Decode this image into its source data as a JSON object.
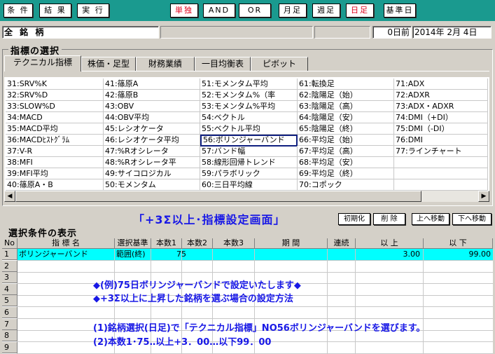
{
  "toolbar": {
    "buttons": [
      {
        "label": "条 件"
      },
      {
        "label": "結 果"
      },
      {
        "label": "実 行"
      },
      {
        "label": "単独",
        "red": true
      },
      {
        "label": "AND"
      },
      {
        "label": "OR"
      },
      {
        "label": "月足"
      },
      {
        "label": "週足"
      },
      {
        "label": "日足",
        "red": true
      },
      {
        "label": "基準日"
      }
    ]
  },
  "header": {
    "stock_value": "全 銘 柄",
    "days_before": "0日前",
    "date": "2014年 2月 4日"
  },
  "indicator_section": {
    "title": "指標の選択",
    "tabs": [
      "テクニカル指標",
      "株価・足型",
      "財務業績",
      "一目均衡表",
      "ピボット"
    ],
    "active_tab": 0,
    "columns": [
      [
        "31:SRV%K",
        "32:SRV%D",
        "33:SLOW%D",
        "34:MACD",
        "35:MACD平均",
        "36:MACDﾋｽﾄｸﾞﾗﾑ",
        "37:V-R",
        "38:MFI",
        "39:MFI平均",
        "40:篠原A・B"
      ],
      [
        "41:篠原A",
        "42:篠原B",
        "43:OBV",
        "44:OBV平均",
        "45:レシオケータ",
        "46:レシオケータ平均",
        "47:%Rオシレータ",
        "48:%Rオシレータ平",
        "49:サイコロジカル",
        "50:モメンタム"
      ],
      [
        "51:モメンタム平均",
        "52:モメンタム%（率",
        "53:モメンタム%平均",
        "54:ベクトル",
        "55:ベクトル平均",
        "56:ボリンジャーバンド",
        "57:バンド幅",
        "58:線形回帰トレンド",
        "59:パラボリック",
        "60:三日平均線"
      ],
      [
        "61:転換足",
        "62:陰陽足（始）",
        "63:陰陽足（高）",
        "64:陰陽足（安）",
        "65:陰陽足（終）",
        "66:平均足（始）",
        "67:平均足（高）",
        "68:平均足（安）",
        "69:平均足（終）",
        "70:コポック"
      ],
      [
        "71:ADX",
        "72:ADXR",
        "73:ADX・ADXR",
        "74:DMI（+DI）",
        "75:DMI（-DI）",
        "76:DMI",
        "77:ラインチャート",
        "",
        "",
        ""
      ]
    ],
    "selected": {
      "col": 2,
      "row": 5
    }
  },
  "banner": "「+3Σ以上･指標設定画面」",
  "action_buttons": [
    "初期化",
    "削 除",
    "上へ移動",
    "下へ移動"
  ],
  "condition_section": {
    "title": "選択条件の表示",
    "headers": [
      "No",
      "指 標 名",
      "選択基準",
      "本数1",
      "本数2",
      "本数3",
      "期 間",
      "連続",
      "以 上",
      "以 下"
    ],
    "row_numbers": [
      "1",
      "2",
      "3",
      "4",
      "5",
      "6",
      "7",
      "8",
      "9"
    ],
    "row1": {
      "name": "ボリンジャーバンド",
      "criterion": "範囲(終)",
      "count1": "75",
      "min": "3.00",
      "max": "99.00"
    }
  },
  "notes": {
    "line1": "◆(例)75日ボリンジャーバンドで設定いたします◆",
    "line2": "◆+3Σ以上に上昇した銘柄を選ぶ場合の設定方法",
    "line3": "(1)銘柄選択(日足)で「テクニカル指標」NO56ボリンジャーバンドを選びます。",
    "line4": "(2)本数1･75‥以上+3．00…以下99．00"
  },
  "colors": {
    "toolbar_bg": "#1a9a8f",
    "selected_row_bg": "#00ffff",
    "note_text": "#1818e6",
    "banner_text": "#1818e6",
    "red_button_text": "#e0001c"
  },
  "icons": {
    "scroll_left": "triangle-left-icon",
    "scroll_right": "triangle-right-icon"
  }
}
